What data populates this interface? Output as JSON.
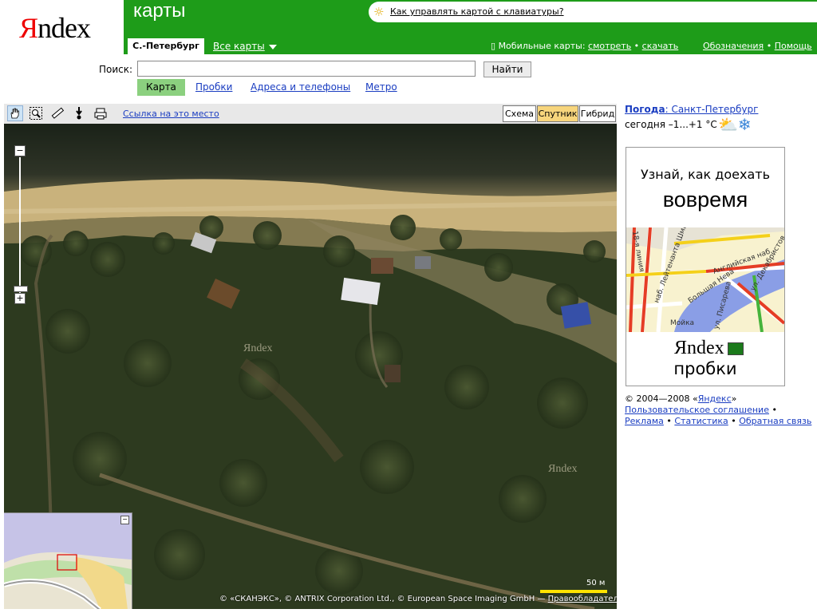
{
  "header": {
    "logo_y": "Я",
    "logo_rest": "ndex",
    "app_title": "карты",
    "keyboard_hint": "Как управлять картой с клавиатуры?",
    "city_tab": "С.-Петербург",
    "all_maps": "Все карты",
    "mobile_label": "Мобильные карты:",
    "mobile_view": "смотреть",
    "mobile_download": "скачать",
    "legend_link": "Обозначения",
    "help_link": "Помощь",
    "sep": "•"
  },
  "search": {
    "label": "Поиск:",
    "value": "",
    "placeholder": "",
    "button": "Найти"
  },
  "modes": [
    "Карта",
    "Пробки",
    "Адреса и телефоны",
    "Метро"
  ],
  "map_toolbar": {
    "link_here": "Ссылка на это место",
    "layers": [
      "Схема",
      "Спутник",
      "Гибрид"
    ],
    "active_layer": "Спутник"
  },
  "map": {
    "scale_label": "50 м",
    "copyright": "© «СКАНЭКС», © ANTRIX Corporation Ltd., © European Space Imaging GmbH —",
    "rights_link": "Правообладатели",
    "watermark": "Яndex"
  },
  "weather": {
    "link": "Погода",
    "city": ": Санкт-Петербург",
    "today": "сегодня –1...+1 °С"
  },
  "ad": {
    "line1": "Узнай, как доехать",
    "line2": "вовремя",
    "logo": "Яndex",
    "product": "пробки",
    "street_labels": [
      "наб. Лейтенанта Шмидта",
      "Большая Нева",
      "Английская наб.",
      "Мойка",
      "ул. Писарева",
      "18-я линия",
      "ул. Декабристов"
    ]
  },
  "footer": {
    "copyright_prefix": "© 2004—2008 «",
    "yandex_link": "Яндекс",
    "copyright_suffix": "»",
    "agreement": "Пользовательское соглашение",
    "ads": "Реклама",
    "stats": "Статистика",
    "feedback": "Обратная связь"
  },
  "colors": {
    "brand_green": "#1e9c19",
    "link": "#1a3dc1",
    "active_mode": "#8bd07f",
    "active_layer": "#f7d57c",
    "scale_bar": "#ffe300"
  }
}
